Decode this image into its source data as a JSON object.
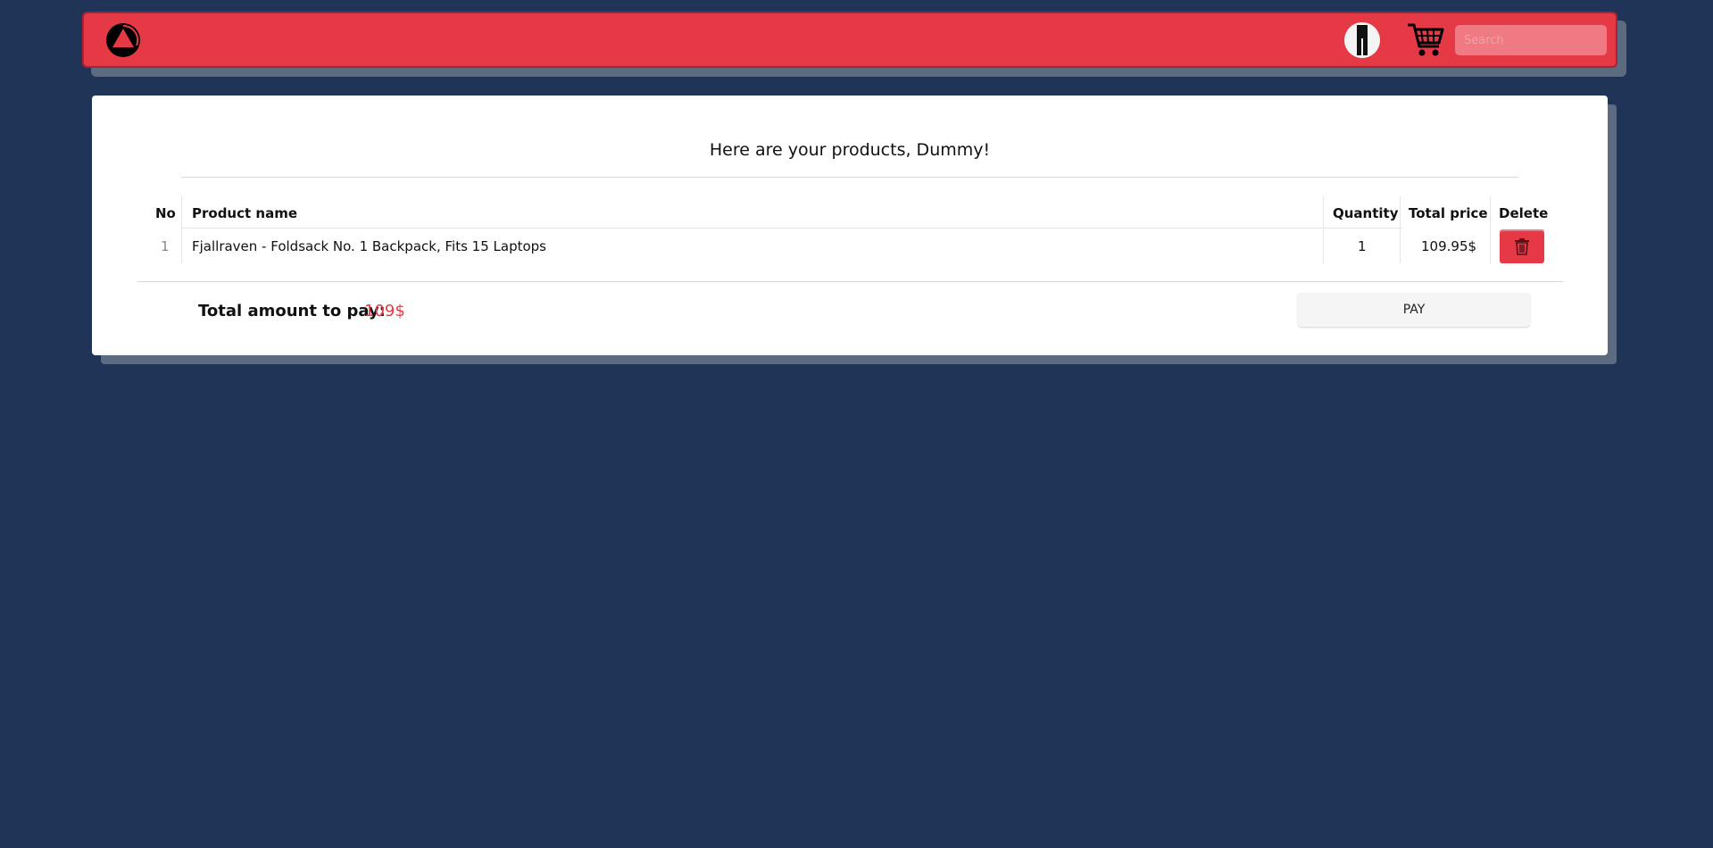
{
  "navbar": {
    "logo_icon": "circle-triangle-logo-icon",
    "avatar_icon": "user-avatar-icon",
    "cart_icon": "shopping-cart-icon",
    "search_placeholder": "Search",
    "accent_color": "#e63946"
  },
  "cart": {
    "greeting": "Here are your products, Dummy!",
    "columns": {
      "no": "No",
      "product": "Product name",
      "quantity": "Quantity",
      "total_price": "Total price",
      "delete": "Delete"
    },
    "rows": [
      {
        "no": "1",
        "product": "Fjallraven - Foldsack No. 1 Backpack, Fits 15 Laptops",
        "quantity": "1",
        "total_price": "109.95$",
        "delete_icon": "trash-icon"
      }
    ],
    "total_label": "Total amount to pay:",
    "total_value": "109$",
    "pay_label": "PAY"
  },
  "colors": {
    "background": "#1f3456",
    "shadow": "#5d6b80",
    "total_value": "#e63946"
  }
}
